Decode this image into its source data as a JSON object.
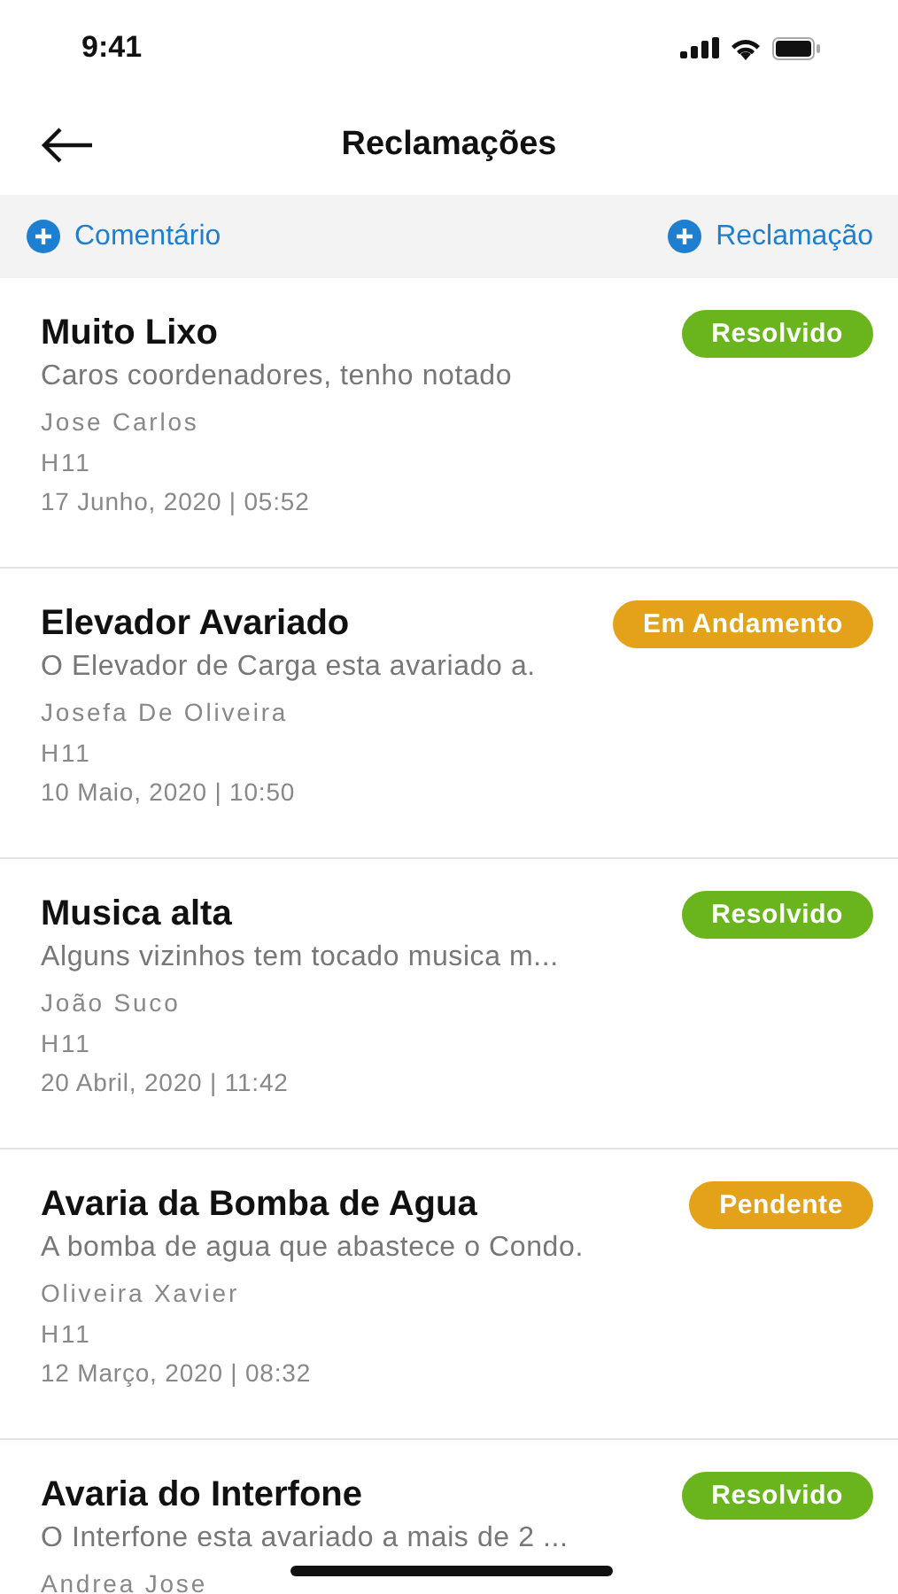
{
  "status_bar": {
    "time": "9:41"
  },
  "header": {
    "title": "Reclamações"
  },
  "actions": [
    {
      "label": "Comentário"
    },
    {
      "label": "Reclamação"
    }
  ],
  "complaints": [
    {
      "title": "Muito Lixo",
      "status": {
        "label": "Resolvido",
        "color": "#6ab41e"
      },
      "description": "Caros coordenadores, tenho notado",
      "author": "Jose Carlos",
      "unit": "H11",
      "date": "17 Junho, 2020 | 05:52"
    },
    {
      "title": "Elevador Avariado",
      "status": {
        "label": "Em Andamento",
        "color": "#e3a21a"
      },
      "description": "O Elevador de Carga esta avariado a.",
      "author": "Josefa De Oliveira",
      "unit": "H11",
      "date": "10 Maio, 2020 | 10:50"
    },
    {
      "title": "Musica alta",
      "status": {
        "label": "Resolvido",
        "color": "#6ab41e"
      },
      "description": "Alguns vizinhos tem tocado musica m...",
      "author": "João Suco",
      "unit": "H11",
      "date": "20 Abril, 2020 | 11:42"
    },
    {
      "title": "Avaria da Bomba de Agua",
      "status": {
        "label": "Pendente",
        "color": "#e3a21a"
      },
      "description": "A bomba de agua que abastece o Condo.",
      "author": "Oliveira Xavier",
      "unit": "H11",
      "date": "12 Março, 2020 | 08:32"
    },
    {
      "title": "Avaria do Interfone",
      "status": {
        "label": "Resolvido",
        "color": "#6ab41e"
      },
      "description": "O Interfone esta avariado a mais de 2 ...",
      "author": "Andrea Jose"
    }
  ]
}
